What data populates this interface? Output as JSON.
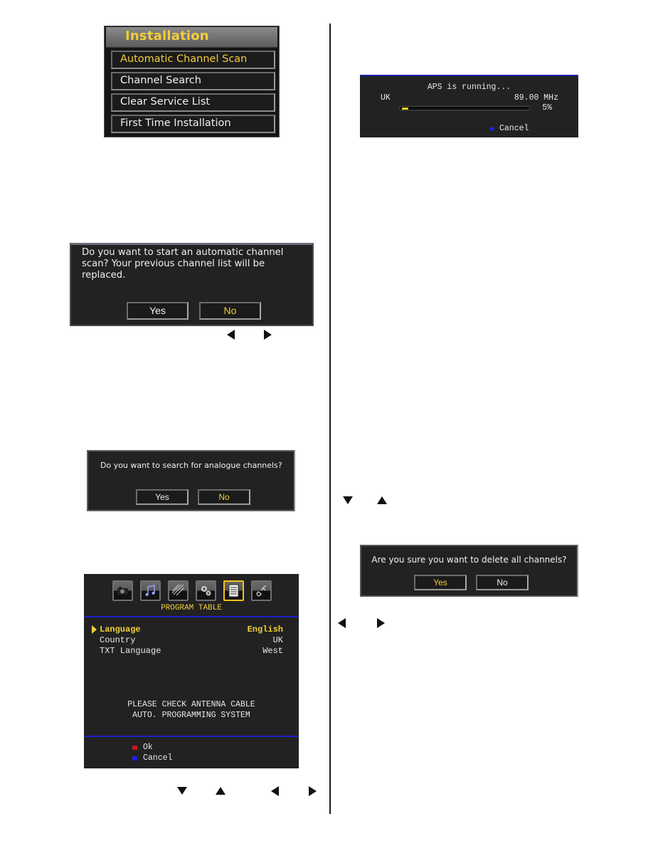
{
  "installation_menu": {
    "title": "Installation",
    "items": [
      {
        "label": "Automatic Channel Scan",
        "active": true
      },
      {
        "label": "Channel Search",
        "active": false
      },
      {
        "label": "Clear Service List",
        "active": false
      },
      {
        "label": "First Time Installation",
        "active": false
      }
    ]
  },
  "auto_scan_dialog": {
    "message": "Do you want to start an automatic channel scan? Your previous channel list will be replaced.",
    "yes_label": "Yes",
    "no_label": "No",
    "focused": "No"
  },
  "nav_hint_1": {
    "icons": [
      "left-arrow",
      "right-arrow"
    ]
  },
  "analogue_dialog": {
    "message": "Do you want to search for analogue channels?",
    "yes_label": "Yes",
    "no_label": "No",
    "focused": "No"
  },
  "program_table": {
    "icons": [
      "camera-icon",
      "music-icon",
      "streaks-icon",
      "gears-icon",
      "document-icon",
      "satellite-icon"
    ],
    "selected_icon": "document-icon",
    "title": "PROGRAM TABLE",
    "rows": [
      {
        "label": "Language",
        "value": "English",
        "selected": true
      },
      {
        "label": "Country",
        "value": "UK",
        "selected": false
      },
      {
        "label": "TXT Language",
        "value": "West",
        "selected": false
      }
    ],
    "notice_line1": "PLEASE CHECK ANTENNA CABLE",
    "notice_line2": "AUTO. PROGRAMMING SYSTEM",
    "keys": [
      {
        "color": "#c41a1a",
        "label": "Ok"
      },
      {
        "color": "#1a22e0",
        "label": "Cancel"
      }
    ],
    "accent_color": "#f2cd3a",
    "bar_color": "#1a22c8"
  },
  "nav_hint_2": {
    "icons": [
      "down-arrow",
      "up-arrow",
      "left-arrow",
      "right-arrow"
    ]
  },
  "aps_progress": {
    "status": "APS is running...",
    "country": "UK",
    "frequency": "89.00 MHz",
    "progress_percent": 5,
    "progress_label": "5%",
    "cancel_label": "Cancel",
    "cancel_color": "#1a22e0"
  },
  "nav_hint_3": {
    "icons": [
      "down-arrow",
      "up-arrow"
    ]
  },
  "delete_dialog": {
    "message": "Are you sure you want to delete all channels?",
    "yes_label": "Yes",
    "no_label": "No",
    "focused": "Yes"
  },
  "nav_hint_4": {
    "icons": [
      "left-arrow",
      "right-arrow"
    ]
  }
}
